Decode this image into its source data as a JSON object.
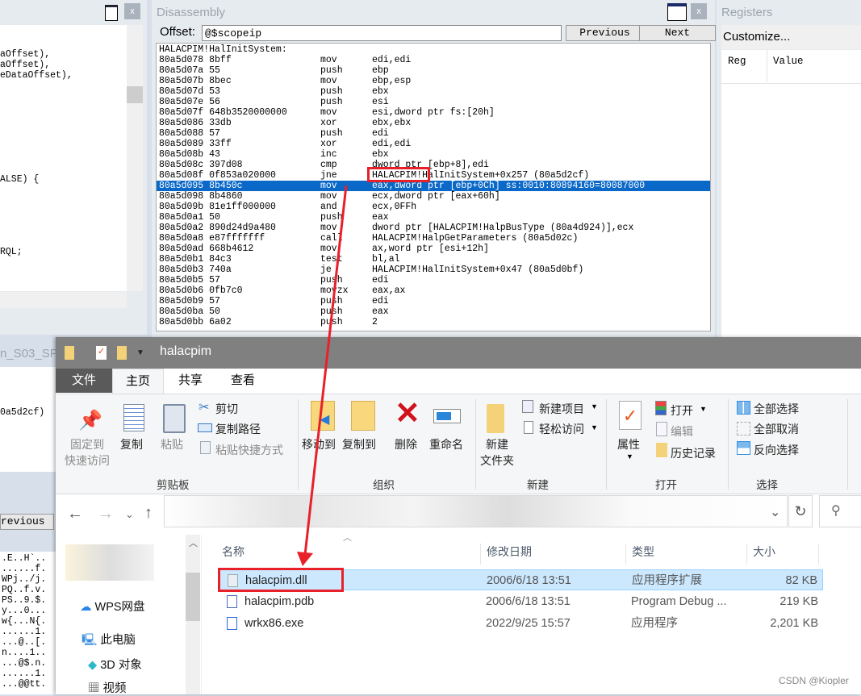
{
  "left_panel": {
    "lines": [
      "aOffset),",
      "aOffset),",
      "eDataOffset),",
      "ALSE) {",
      "RQL;"
    ],
    "behind_tab": "n_S03_SP",
    "behind_text": "0a5d2cf)",
    "behind_button": "revious",
    "hex_ascii": [
      ".E..H`..",
      "......f.",
      "WPj../j.",
      "PQ..f.v.",
      "PS..9.$.",
      "y...0...",
      "w{...N{.",
      "......1.",
      "...@..[.",
      "n....1..",
      "...@$.n.",
      "......1.",
      "...@@tt."
    ]
  },
  "disassembly": {
    "title": "Disassembly",
    "offset_label": "Offset:",
    "offset_value": "@$scopeip",
    "previous": "Previous",
    "next": "Next",
    "header": "HALACPIM!HalInitSystem:",
    "lines": [
      [
        "80a5d078",
        "8bff",
        "mov",
        "edi,edi"
      ],
      [
        "80a5d07a",
        "55",
        "push",
        "ebp"
      ],
      [
        "80a5d07b",
        "8bec",
        "mov",
        "ebp,esp"
      ],
      [
        "80a5d07d",
        "53",
        "push",
        "ebx"
      ],
      [
        "80a5d07e",
        "56",
        "push",
        "esi"
      ],
      [
        "80a5d07f",
        "648b3520000000",
        "mov",
        "esi,dword ptr fs:[20h]"
      ],
      [
        "80a5d086",
        "33db",
        "xor",
        "ebx,ebx"
      ],
      [
        "80a5d088",
        "57",
        "push",
        "edi"
      ],
      [
        "80a5d089",
        "33ff",
        "xor",
        "edi,edi"
      ],
      [
        "80a5d08b",
        "43",
        "inc",
        "ebx"
      ],
      [
        "80a5d08c",
        "397d08",
        "cmp",
        "dword ptr [ebp+8],edi"
      ],
      [
        "80a5d08f",
        "0f853a020000",
        "jne",
        "HALACPIM!HalInitSystem+0x257 (80a5d2cf)"
      ],
      [
        "80a5d095",
        "8b450c",
        "mov",
        "eax,dword ptr [ebp+0Ch] ss:0010:80894160=80087000"
      ],
      [
        "80a5d098",
        "8b4860",
        "mov",
        "ecx,dword ptr [eax+60h]"
      ],
      [
        "80a5d09b",
        "81e1ff000000",
        "and",
        "ecx,0FFh"
      ],
      [
        "80a5d0a1",
        "50",
        "push",
        "eax"
      ],
      [
        "80a5d0a2",
        "890d24d9a480",
        "mov",
        "dword ptr [HALACPIM!HalpBusType (80a4d924)],ecx"
      ],
      [
        "80a5d0a8",
        "e87fffffff",
        "call",
        "HALACPIM!HalpGetParameters (80a5d02c)"
      ],
      [
        "80a5d0ad",
        "668b4612",
        "mov",
        "ax,word ptr [esi+12h]"
      ],
      [
        "80a5d0b1",
        "84c3",
        "test",
        "bl,al"
      ],
      [
        "80a5d0b3",
        "740a",
        "je",
        "HALACPIM!HalInitSystem+0x47 (80a5d0bf)"
      ],
      [
        "80a5d0b5",
        "57",
        "push",
        "edi"
      ],
      [
        "80a5d0b6",
        "0fb7c0",
        "movzx",
        "eax,ax"
      ],
      [
        "80a5d0b9",
        "57",
        "push",
        "edi"
      ],
      [
        "80a5d0ba",
        "50",
        "push",
        "eax"
      ],
      [
        "80a5d0bb",
        "6a02",
        "push",
        "2"
      ]
    ],
    "selected_index": 12
  },
  "registers": {
    "title": "Registers",
    "customize": "Customize...",
    "col_reg": "Reg",
    "col_value": "Value"
  },
  "explorer": {
    "title": "halacpim",
    "tabs": [
      {
        "label": "文件"
      },
      {
        "label": "主页"
      },
      {
        "label": "共享"
      },
      {
        "label": "查看"
      }
    ],
    "ribbon": {
      "pin": "固定到\n快速访问",
      "copy": "复制",
      "paste": "粘贴",
      "cut": "剪切",
      "copy_path": "复制路径",
      "paste_shortcut": "粘贴快捷方式",
      "g_clipboard": "剪贴板",
      "move_to": "移动到",
      "copy_to": "复制到",
      "delete": "删除",
      "rename": "重命名",
      "g_organize": "组织",
      "new_folder": "新建\n文件夹",
      "new_item": "新建项目",
      "easy_access": "轻松访问",
      "g_new": "新建",
      "properties": "属性",
      "open": "打开",
      "edit": "编辑",
      "history": "历史记录",
      "g_open": "打开",
      "select_all": "全部选择",
      "select_none": "全部取消",
      "invert": "反向选择",
      "g_select": "选择"
    },
    "nav": [
      {
        "label": "WPS网盘"
      },
      {
        "label": "此电脑"
      },
      {
        "label": "3D 对象"
      },
      {
        "label": "视频"
      }
    ],
    "columns": {
      "name": "名称",
      "date": "修改日期",
      "type": "类型",
      "size": "大小"
    },
    "files": [
      {
        "name": "halacpim.dll",
        "date": "2006/6/18 13:51",
        "type": "应用程序扩展",
        "size": "82 KB",
        "selected": true
      },
      {
        "name": "halacpim.pdb",
        "date": "2006/6/18 13:51",
        "type": "Program Debug ...",
        "size": "219 KB"
      },
      {
        "name": "wrkx86.exe",
        "date": "2022/9/25 15:57",
        "type": "应用程序",
        "size": "2,201 KB"
      }
    ]
  },
  "watermark": "CSDN @Kiopler",
  "colors": {
    "selection": "#0a68c8",
    "annotation": "#e8202a",
    "file_selected": "#cce8ff"
  }
}
